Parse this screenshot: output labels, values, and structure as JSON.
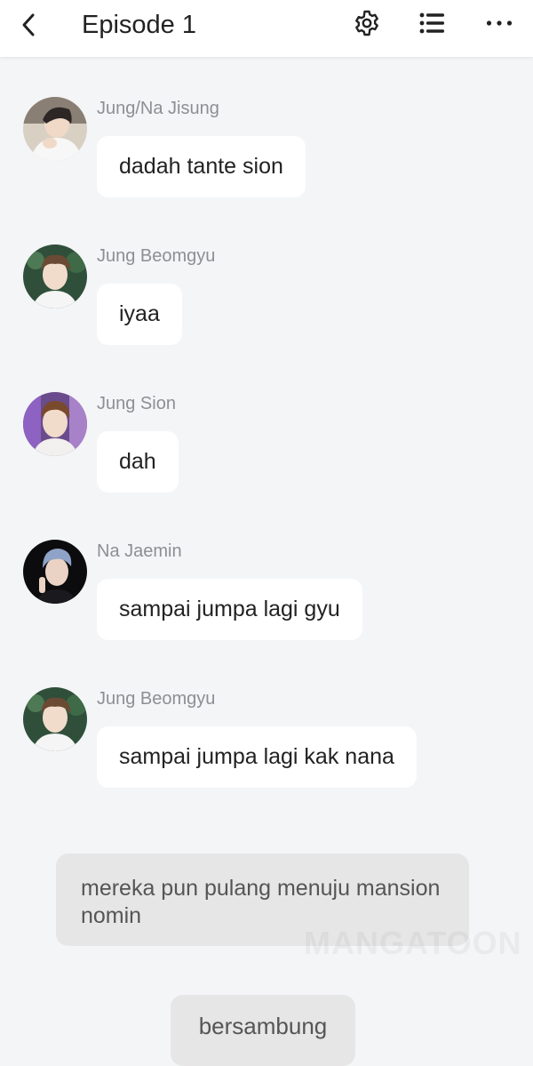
{
  "header": {
    "title": "Episode 1",
    "icons": [
      "back-chevron-icon",
      "gear-icon",
      "list-icon",
      "more-dots-icon"
    ]
  },
  "messages": [
    {
      "sender": "Jung/Na Jisung",
      "text": "dadah tante sion",
      "avatar": "avatar-jisung"
    },
    {
      "sender": "Jung Beomgyu",
      "text": "iyaa",
      "avatar": "avatar-beomgyu"
    },
    {
      "sender": "Jung Sion",
      "text": "dah",
      "avatar": "avatar-sion"
    },
    {
      "sender": "Na Jaemin",
      "text": "sampai jumpa lagi gyu",
      "avatar": "avatar-jaemin"
    },
    {
      "sender": "Jung Beomgyu",
      "text": "sampai jumpa lagi kak nana",
      "avatar": "avatar-beomgyu"
    }
  ],
  "narration": "mereka pun pulang menuju mansion nomin",
  "watermark": "MANGATOON",
  "end_label": "bersambung",
  "colors": {
    "background": "#f4f5f7",
    "bubble": "#ffffff",
    "sender_name": "#8e8e93",
    "narration_bg": "#e6e6e6"
  }
}
